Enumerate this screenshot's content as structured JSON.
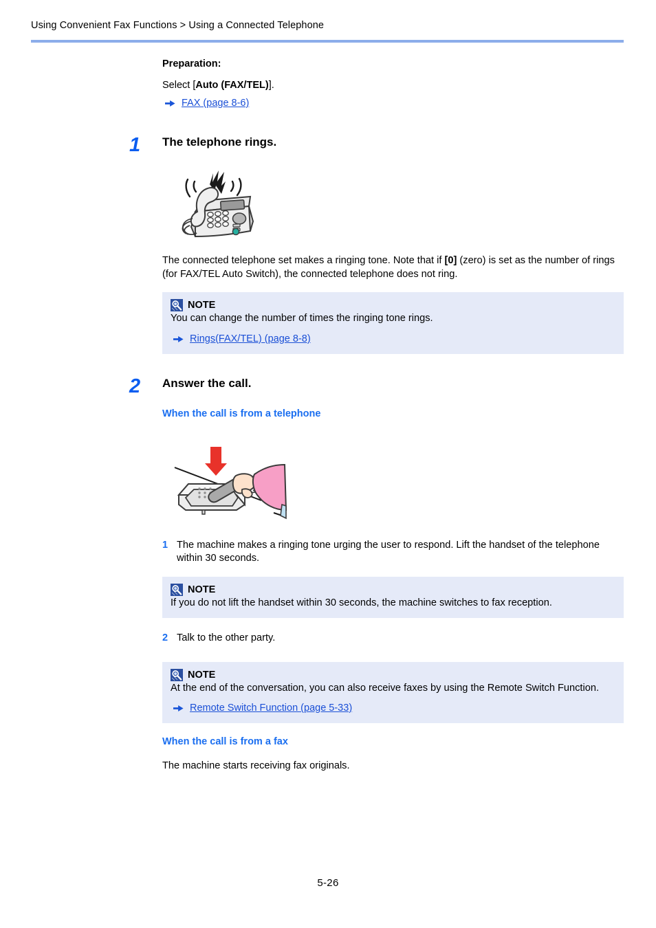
{
  "header": {
    "breadcrumb": "Using Convenient Fax Functions > Using a Connected Telephone",
    "rule_color": "#8cadea"
  },
  "colors": {
    "link": "#1a4fd6",
    "step_number": "#0a5df0",
    "sub_heading": "#1a6ef0",
    "note_background": "#e5eaf8",
    "note_icon": "#2b4fa0",
    "arrow": "#1a55d8",
    "illustration_accent_red": "#e8322a",
    "illustration_accent_pink": "#f79fc6",
    "illustration_accent_teal": "#26b0a0"
  },
  "preparation": {
    "title": "Preparation:",
    "instruction_prefix": "Select [",
    "instruction_bold": "Auto (FAX/TEL)",
    "instruction_suffix": "].",
    "link": "FAX (page 8-6)",
    "arrow_icon": "arrow-right-icon"
  },
  "steps": [
    {
      "number": "1",
      "title": "The telephone rings.",
      "figure": "ringing-telephone-illustration",
      "body_part1": "The connected telephone set makes a ringing tone. Note that if ",
      "body_bold": "[0]",
      "body_part2": " (zero) is set as the number of rings (for FAX/TEL Auto Switch), the connected telephone does not ring.",
      "note": {
        "icon": "note-icon",
        "label": "NOTE",
        "text": "You can change the number of times the ringing tone rings.",
        "link": "Rings(FAX/TEL) (page 8-8)",
        "arrow_icon": "arrow-right-icon"
      }
    },
    {
      "number": "2",
      "title": "Answer the call.",
      "sub_heading_telephone": "When the call is from a telephone",
      "figure": "lift-handset-illustration",
      "substeps": [
        {
          "number": "1",
          "text": "The machine makes a ringing tone urging the user to respond. Lift the handset of the telephone within 30 seconds.",
          "note": {
            "icon": "note-icon",
            "label": "NOTE",
            "text": "If you do not lift the handset within 30 seconds, the machine switches to fax reception."
          }
        },
        {
          "number": "2",
          "text": "Talk to the other party.",
          "note": {
            "icon": "note-icon",
            "label": "NOTE",
            "text": "At the end of the conversation, you can also receive faxes by using the Remote Switch Function.",
            "link": "Remote Switch Function (page 5-33)",
            "arrow_icon": "arrow-right-icon"
          }
        }
      ],
      "sub_heading_fax": "When the call is from a fax",
      "fax_text": "The machine starts receiving fax originals."
    }
  ],
  "footer": {
    "page_number": "5-26"
  }
}
